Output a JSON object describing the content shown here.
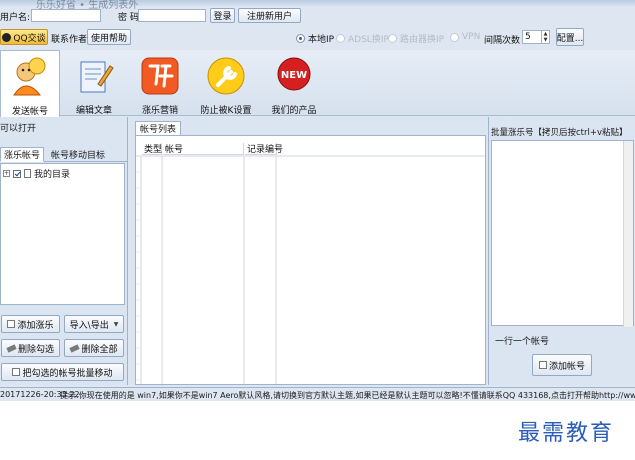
{
  "window": {
    "title": "乐乐好省 • 生成列表外"
  },
  "login": {
    "username_label": "用户名:",
    "username_value": "",
    "password_label": "密 码:",
    "password_value": "",
    "login_button": "登录",
    "register_button": "注册新用户"
  },
  "row2": {
    "qq_button": "QQ交谈",
    "contact_author": "联系作者",
    "help_button": "使用帮助",
    "radios": [
      {
        "label": "本地IP",
        "checked": true,
        "enabled": true
      },
      {
        "label": "ADSL换IP",
        "checked": false,
        "enabled": false
      },
      {
        "label": "路由器换IP",
        "checked": false,
        "enabled": false
      },
      {
        "label": "VPN",
        "checked": false,
        "enabled": false
      }
    ],
    "interval_label": "间隔次数",
    "interval_value": "5",
    "config_button": "配置..."
  },
  "ribbon": {
    "tools": [
      {
        "label": "发送帐号",
        "icon": "user-group-icon",
        "active": true
      },
      {
        "label": "编辑文章",
        "icon": "edit-document-icon",
        "active": false
      },
      {
        "label": "涨乐营销",
        "icon": "zhang-logo-icon",
        "active": false
      },
      {
        "label": "防止被K设置",
        "icon": "wrench-icon",
        "active": false
      },
      {
        "label": "我们的产品",
        "icon": "new-badge-icon",
        "active": false
      }
    ]
  },
  "left_panel": {
    "title": "可以打开",
    "tabs": [
      "涨乐帐号",
      "帐号移动目标"
    ],
    "tree_item": "我的目录",
    "buttons": {
      "add": "添加涨乐",
      "import_export": "导入\\导出",
      "delete_checked": "删除勾选",
      "delete_all": "删除全部",
      "batch_move": "把勾选的帐号批量移动"
    }
  },
  "list": {
    "tab": "帐号列表",
    "columns": [
      "类型",
      "帐号",
      "记录编号"
    ]
  },
  "right_panel": {
    "title": "批量涨乐号【拷贝后按ctrl+v粘贴】",
    "hint": "一行一个帐号",
    "add_button": "添加帐号"
  },
  "status": {
    "time": "20171226-20:33:22",
    "message": "提示:你现在使用的是 win7,如果你不是win7 Aero默认风格,请切换到官方默认主题,如果已经是默认主题可以忽略!不懂请联系QQ 433168,点击打开帮助http://www.sqq"
  },
  "watermark": "最需教育",
  "colors": {
    "accent": "#2a5cb8",
    "panel": "#dbe5f1",
    "border": "#9fb3cc"
  }
}
